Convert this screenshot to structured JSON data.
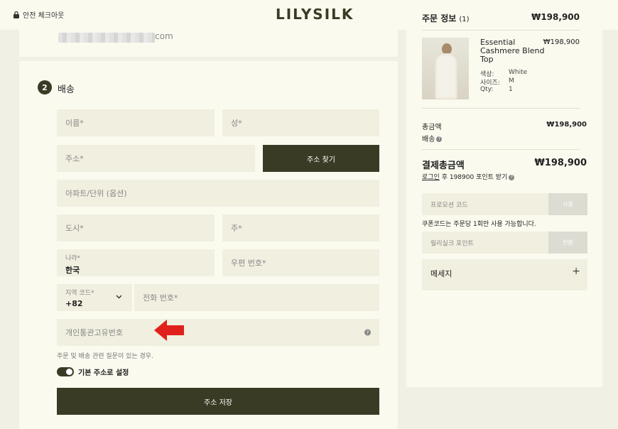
{
  "header": {
    "secure_checkout": "안전 체크아웃",
    "logo": "LILYSILK"
  },
  "email": {
    "suffix": "com"
  },
  "shipping": {
    "step_number": "2",
    "title": "배송",
    "fields": {
      "first_name": "이름*",
      "last_name": "성*",
      "address": "주소*",
      "find_address_button": "주소 찾기",
      "apartment": "아파트/단위 (옵션)",
      "city": "도시*",
      "state": "주*",
      "country_label": "나라*",
      "country_value": "한국",
      "postal_code": "우편 번호*",
      "area_code_label": "지역 코드*",
      "area_code_value": "+82",
      "phone": "전화 번호*",
      "customs_id": "개인통관고유번호"
    },
    "hint": "주문 및 배송 관련 질문이 있는 경우.",
    "default_address_label": "기본 주소로 설정",
    "save_button": "주소 저장"
  },
  "summary": {
    "title": "주문 정보",
    "count": "(1)",
    "total_top": "₩198,900",
    "product": {
      "name": "Essential Cashmere Blend Top",
      "price": "₩198,900",
      "color_label": "색상:",
      "color_value": "White",
      "size_label": "사이즈:",
      "size_value": "M",
      "qty_label": "Qty:",
      "qty_value": "1"
    },
    "subtotal_label": "총금액",
    "subtotal_value": "₩198,900",
    "shipping_label": "배송",
    "grand_label": "결제총금액",
    "grand_value": "₩198,900",
    "login_link": "로그인",
    "points_text": "후 198900 포인트 받기",
    "promo_placeholder": "프로모션 코드",
    "promo_button": "사용",
    "coupon_note": "쿠폰코드는 주문당 1회만 사용 가능합니다.",
    "points_placeholder": "릴리실크 포인트",
    "points_button": "전환",
    "message_label": "메세지",
    "message_toggle": "+"
  },
  "colors": {
    "accent": "#3a3b25",
    "arrow": "#e0201c",
    "background": "#f1f0e4",
    "card": "#fbfaef"
  }
}
